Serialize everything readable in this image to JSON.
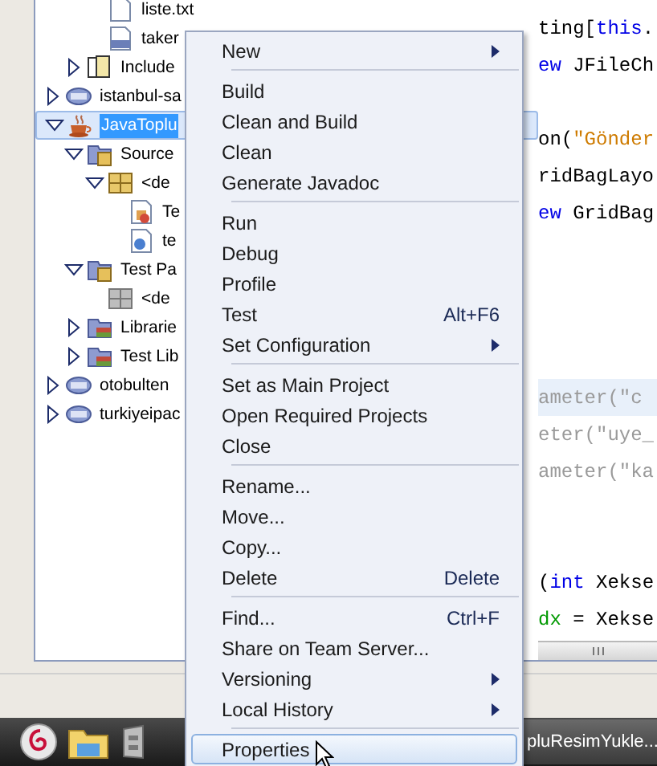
{
  "project_tree": [
    {
      "children": [
        {
          "children": [
            {
              "label": "liste.txt",
              "kind": "text-file",
              "selected": false
            },
            {
              "label": "taker",
              "kind": "php-file",
              "selected": false
            }
          ]
        },
        {
          "label": "Include",
          "kind": "include",
          "expanded": false,
          "selected": false
        }
      ]
    },
    {
      "label": "istanbul-sa",
      "kind": "php-project",
      "expanded": false,
      "selected": false
    },
    {
      "label": "JavaToplu",
      "kind": "java-project",
      "expanded": true,
      "selected": true,
      "children": [
        {
          "label": "Source",
          "kind": "source-folder",
          "expanded": true,
          "selected": false,
          "children": [
            {
              "label": "<de",
              "kind": "package",
              "expanded": true,
              "selected": false,
              "children": [
                {
                  "label": "Te",
                  "kind": "form-file",
                  "selected": false
                },
                {
                  "label": "te",
                  "kind": "java-file",
                  "selected": false
                }
              ]
            }
          ]
        },
        {
          "label": "Test Pa",
          "kind": "source-folder",
          "expanded": true,
          "selected": false,
          "children": [
            {
              "label": "<de",
              "kind": "empty-package",
              "selected": false
            }
          ]
        },
        {
          "label": "Librarie",
          "kind": "library",
          "expanded": false,
          "selected": false
        },
        {
          "label": "Test Lib",
          "kind": "library",
          "expanded": false,
          "selected": false
        }
      ]
    },
    {
      "label": "otobulten",
      "kind": "php-project",
      "expanded": false,
      "selected": false
    },
    {
      "label": "turkiyeipac",
      "kind": "php-project",
      "expanded": false,
      "selected": false
    }
  ],
  "editor": {
    "lines": [
      {
        "kind": "code",
        "highlighted": false,
        "segments": [
          {
            "text": "ting[",
            "kind": "plain"
          },
          {
            "text": "this",
            "kind": "keyword"
          },
          {
            "text": ".",
            "kind": "plain"
          }
        ]
      },
      {
        "kind": "code",
        "highlighted": false,
        "segments": [
          {
            "text": "ew",
            "kind": "keyword"
          },
          {
            "text": " JFileCh",
            "kind": "plain"
          }
        ]
      },
      {
        "kind": "blank"
      },
      {
        "kind": "code",
        "highlighted": false,
        "segments": [
          {
            "text": "on(",
            "kind": "plain"
          },
          {
            "text": "\"Gönder",
            "kind": "string"
          }
        ]
      },
      {
        "kind": "code",
        "highlighted": false,
        "segments": [
          {
            "text": "ridBagLayo",
            "kind": "plain"
          }
        ]
      },
      {
        "kind": "code",
        "highlighted": false,
        "segments": [
          {
            "text": "ew",
            "kind": "keyword"
          },
          {
            "text": " GridBag",
            "kind": "plain"
          }
        ]
      },
      {
        "kind": "blank"
      },
      {
        "kind": "blank"
      },
      {
        "kind": "blank"
      },
      {
        "kind": "blank"
      },
      {
        "kind": "code",
        "highlighted": true,
        "segments": [
          {
            "text": "ameter(\"c",
            "kind": "dim"
          }
        ]
      },
      {
        "kind": "code",
        "highlighted": false,
        "segments": [
          {
            "text": "eter(\"uye_",
            "kind": "dim"
          }
        ]
      },
      {
        "kind": "code",
        "highlighted": false,
        "segments": [
          {
            "text": "ameter(\"ka",
            "kind": "dim"
          }
        ]
      },
      {
        "kind": "blank"
      },
      {
        "kind": "blank"
      },
      {
        "kind": "code",
        "highlighted": false,
        "segments": [
          {
            "text": "(",
            "kind": "plain"
          },
          {
            "text": "int",
            "kind": "keyword"
          },
          {
            "text": " Xekse",
            "kind": "plain"
          }
        ]
      },
      {
        "kind": "code",
        "highlighted": false,
        "segments": [
          {
            "text": "dx",
            "kind": "field"
          },
          {
            "text": " = Xekse",
            "kind": "plain"
          }
        ]
      }
    ]
  },
  "context_menu": [
    {
      "kind": "item",
      "label": "New",
      "has_submenu": true,
      "selected": false
    },
    {
      "kind": "separator"
    },
    {
      "kind": "item",
      "label": "Build",
      "has_submenu": false,
      "selected": false
    },
    {
      "kind": "item",
      "label": "Clean and Build",
      "has_submenu": false,
      "selected": false
    },
    {
      "kind": "item",
      "label": "Clean",
      "has_submenu": false,
      "selected": false
    },
    {
      "kind": "item",
      "label": "Generate Javadoc",
      "has_submenu": false,
      "selected": false
    },
    {
      "kind": "separator"
    },
    {
      "kind": "item",
      "label": "Run",
      "has_submenu": false,
      "selected": false
    },
    {
      "kind": "item",
      "label": "Debug",
      "has_submenu": false,
      "selected": false
    },
    {
      "kind": "item",
      "label": "Profile",
      "has_submenu": false,
      "selected": false
    },
    {
      "kind": "item",
      "label": "Test",
      "shortcut": "Alt+F6",
      "has_submenu": false,
      "selected": false
    },
    {
      "kind": "item",
      "label": "Set Configuration",
      "has_submenu": true,
      "selected": false
    },
    {
      "kind": "separator"
    },
    {
      "kind": "item",
      "label": "Set as Main Project",
      "has_submenu": false,
      "selected": false
    },
    {
      "kind": "item",
      "label": "Open Required Projects",
      "has_submenu": false,
      "selected": false
    },
    {
      "kind": "item",
      "label": "Close",
      "has_submenu": false,
      "selected": false
    },
    {
      "kind": "separator"
    },
    {
      "kind": "item",
      "label": "Rename...",
      "has_submenu": false,
      "selected": false
    },
    {
      "kind": "item",
      "label": "Move...",
      "has_submenu": false,
      "selected": false
    },
    {
      "kind": "item",
      "label": "Copy...",
      "has_submenu": false,
      "selected": false
    },
    {
      "kind": "item",
      "label": "Delete",
      "shortcut": "Delete",
      "has_submenu": false,
      "selected": false
    },
    {
      "kind": "separator"
    },
    {
      "kind": "item",
      "label": "Find...",
      "shortcut": "Ctrl+F",
      "has_submenu": false,
      "selected": false
    },
    {
      "kind": "item",
      "label": "Share on Team Server...",
      "has_submenu": false,
      "selected": false
    },
    {
      "kind": "item",
      "label": "Versioning",
      "has_submenu": true,
      "selected": false
    },
    {
      "kind": "item",
      "label": "Local History",
      "has_submenu": true,
      "selected": false
    },
    {
      "kind": "separator"
    },
    {
      "kind": "item",
      "label": "Properties",
      "has_submenu": false,
      "selected": true
    }
  ],
  "taskbar": {
    "window_button": "pluResimYukle..."
  }
}
